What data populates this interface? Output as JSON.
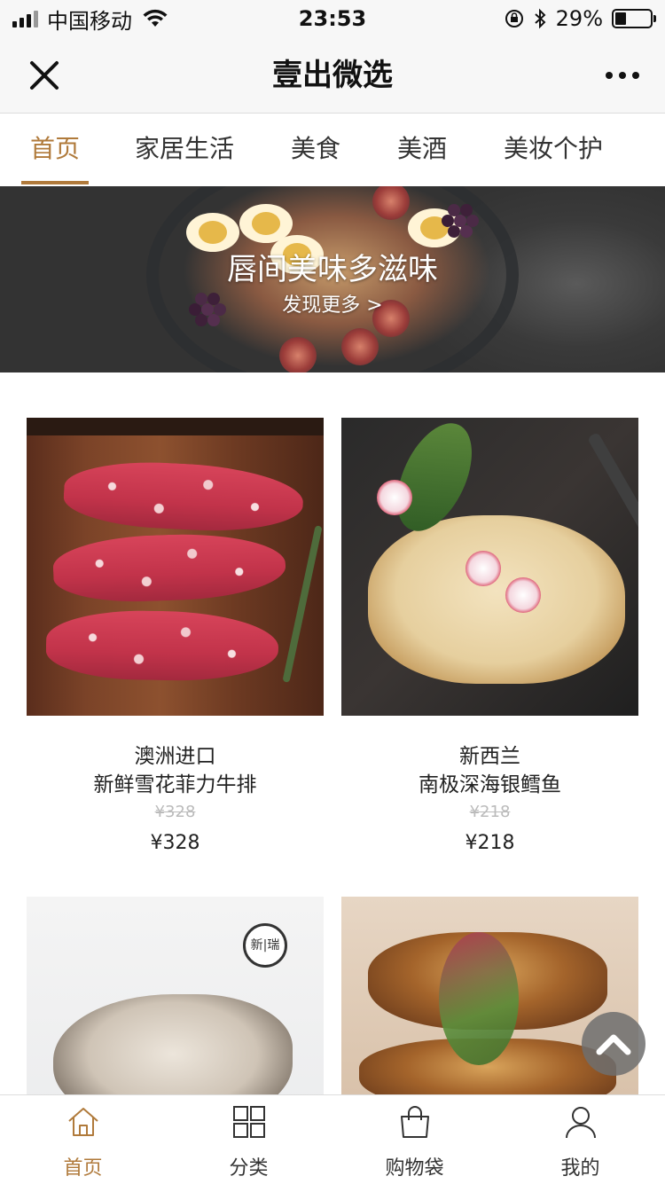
{
  "status_bar": {
    "carrier": "中国移动",
    "time": "23:53",
    "battery": "29%"
  },
  "nav": {
    "title": "壹出微选",
    "close_icon": "close-icon",
    "more_icon": "more-icon"
  },
  "tabs": [
    {
      "label": "首页",
      "active": true
    },
    {
      "label": "家居生活",
      "active": false
    },
    {
      "label": "美食",
      "active": false
    },
    {
      "label": "美酒",
      "active": false
    },
    {
      "label": "美妆个护",
      "active": false
    }
  ],
  "banner": {
    "title": "唇间美味多滋味",
    "cta": "发现更多 >"
  },
  "products": [
    {
      "line1": "澳洲进口",
      "line2": "新鲜雪花菲力牛排",
      "old_price": "¥328",
      "price": "¥328"
    },
    {
      "line1": "新西兰",
      "line2": "南极深海银鳕鱼",
      "old_price": "¥218",
      "price": "¥218"
    },
    {
      "badge": "新|瑞"
    }
  ],
  "bottom_tabs": [
    {
      "label": "首页",
      "icon": "home-icon",
      "active": true
    },
    {
      "label": "分类",
      "icon": "grid-icon",
      "active": false
    },
    {
      "label": "购物袋",
      "icon": "shopping-bag-icon",
      "active": false
    },
    {
      "label": "我的",
      "icon": "user-icon",
      "active": false
    }
  ],
  "colors": {
    "accent": "#b07a3b",
    "text": "#222222",
    "muted": "#bbbbbb"
  }
}
